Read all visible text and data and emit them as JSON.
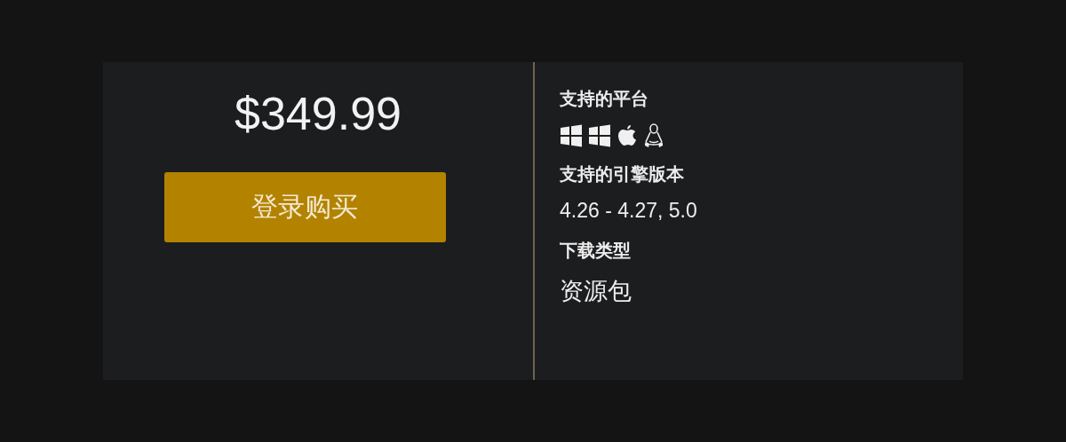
{
  "price": "$349.99",
  "buy_button": {
    "label": "登录购买"
  },
  "details": [
    {
      "heading": "支持的平台",
      "kind": "platforms",
      "platforms": [
        {
          "kind": "windows"
        },
        {
          "kind": "windows"
        },
        {
          "kind": "apple"
        },
        {
          "kind": "linux"
        }
      ]
    },
    {
      "heading": "支持的引擎版本",
      "kind": "text",
      "value": "4.26 - 4.27, 5.0"
    },
    {
      "heading": "下载类型",
      "kind": "large_text",
      "value": "资源包"
    }
  ]
}
